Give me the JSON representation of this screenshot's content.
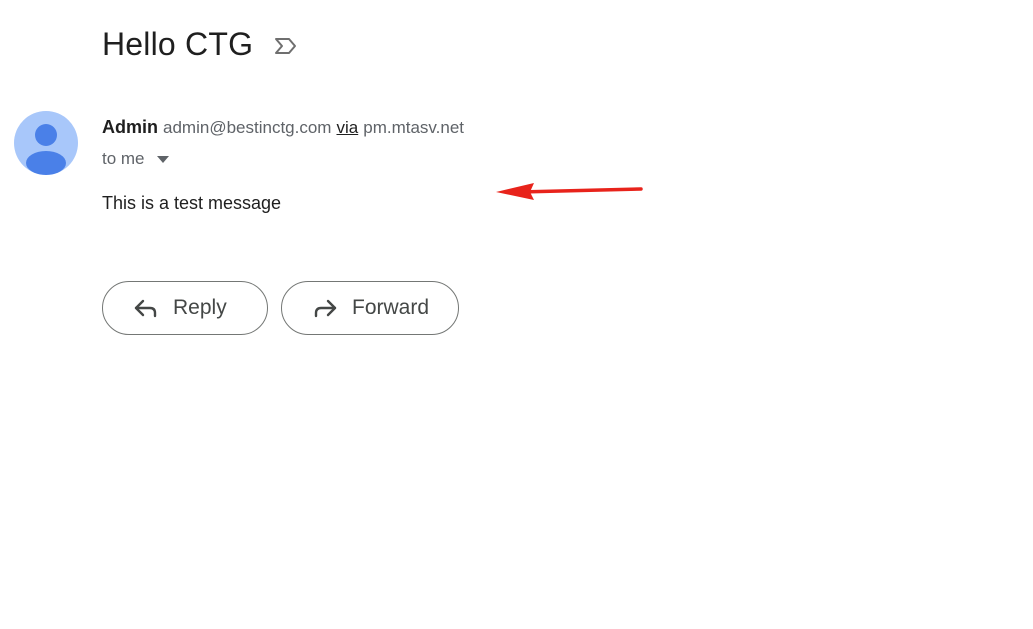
{
  "email": {
    "subject": "Hello CTG",
    "important_icon": "important-label-icon",
    "sender": {
      "name": "Admin",
      "email": "admin@bestinctg.com",
      "via_label": "via",
      "via_domain": "pm.mtasv.net",
      "avatar_icon": "default-person-avatar"
    },
    "recipient": {
      "label": "to me",
      "dropdown_icon": "caret-down-icon"
    },
    "body": "This is a test message"
  },
  "annotation": {
    "arrow_icon": "red-arrow-left-icon",
    "color": "#e8231b"
  },
  "actions": {
    "reply_label": "Reply",
    "reply_icon": "reply-arrow-icon",
    "forward_label": "Forward",
    "forward_icon": "forward-arrow-icon"
  },
  "colors": {
    "avatar_background": "#a8c7fa",
    "avatar_figure": "#4a80e8",
    "text_primary": "#1f1f1f",
    "text_secondary": "#5f6368",
    "button_border": "#747775"
  }
}
